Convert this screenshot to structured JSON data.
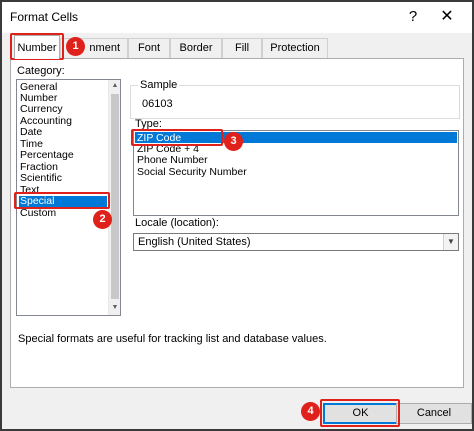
{
  "window": {
    "title": "Format Cells",
    "help_glyph": "?",
    "close_glyph": "✕"
  },
  "tabs": [
    {
      "label": "Number"
    },
    {
      "label": "nment"
    },
    {
      "label": "Font"
    },
    {
      "label": "Border"
    },
    {
      "label": "Fill"
    },
    {
      "label": "Protection"
    }
  ],
  "category": {
    "label": "Category:",
    "items": [
      "General",
      "Number",
      "Currency",
      "Accounting",
      "Date",
      "Time",
      "Percentage",
      "Fraction",
      "Scientific",
      "Text",
      "Special",
      "Custom"
    ],
    "selected": "Special"
  },
  "sample": {
    "label": "Sample",
    "value": "06103"
  },
  "type": {
    "label": "Type:",
    "items": [
      "ZIP Code",
      "ZIP Code + 4",
      "Phone Number",
      "Social Security Number"
    ],
    "selected": "ZIP Code"
  },
  "locale": {
    "label": "Locale (location):",
    "value": "English (United States)"
  },
  "description": "Special formats are useful for tracking list and database values.",
  "buttons": {
    "ok": "OK",
    "cancel": "Cancel"
  },
  "callouts": [
    "1",
    "2",
    "3",
    "4"
  ],
  "colors": {
    "accent": "#0078d7",
    "callout": "#e0201a"
  }
}
